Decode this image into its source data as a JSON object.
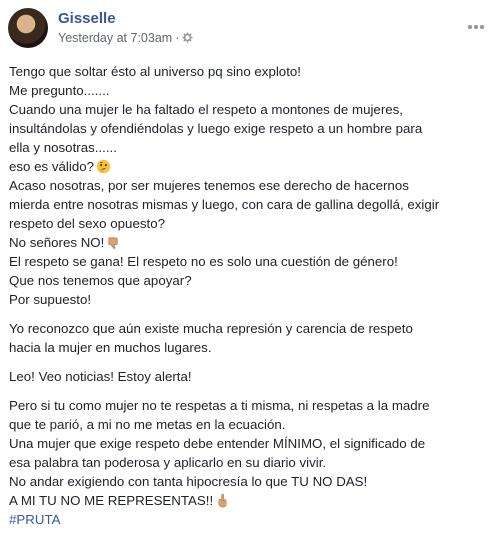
{
  "post": {
    "author": "Gisselle",
    "timestamp": "Yesterday at 7:03am",
    "separator": "·",
    "privacy_icon": "gear-icon",
    "more_icon": "more-options-icon"
  },
  "paragraphs": [
    {
      "lines": [
        "Tengo que soltar ésto al universo pq sino exploto!",
        "Me pregunto.......",
        "Cuando una mujer le ha faltado el respeto a montones de mujeres,",
        "insultándolas y ofendiéndolas y luego exige respeto a un hombre para",
        "ella y nosotras......",
        "eso es válido?",
        "Acaso nosotras, por ser mujeres tenemos ese derecho de hacernos",
        "mierda entre nosotras mismas y luego, con cara de gallina degollá, exigir",
        "respeto del sexo opuesto?",
        "No señores NO!",
        "El respeto se gana! El respeto no es solo una cuestión de género!",
        "Que nos tenemos que apoyar?",
        "Por supuesto!"
      ]
    },
    {
      "lines": [
        "Yo reconozco que aún existe mucha represión y carencia de respeto",
        "hacia la mujer en muchos lugares."
      ]
    },
    {
      "lines": [
        "Leo! Veo noticias! Estoy alerta!"
      ]
    },
    {
      "lines": [
        "Pero si tu como mujer no te respetas a ti misma, ni respetas a la madre",
        "que te parió, a mi no me metas en la ecuación.",
        "Una mujer que exige respeto debe entender MÍNIMO, el significado de",
        "esa palabra tan poderosa y aplicarlo en su diario vivir.",
        "No andar exigiendo con tanta hipocresía lo que TU NO DAS!",
        "A MI TU NO ME REPRESENTAS!!"
      ],
      "hashtag": "#PRUTA"
    }
  ],
  "emojis": {
    "thinking": "thinking-face-icon",
    "thumbs_down": "thumbs-down-icon",
    "middle_finger": "middle-finger-icon"
  }
}
